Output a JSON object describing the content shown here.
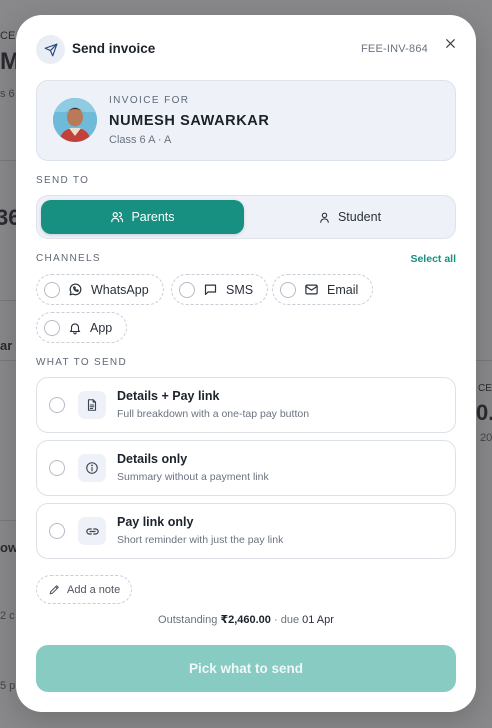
{
  "header": {
    "title": "Send invoice",
    "invoice_id": "FEE-INV-864"
  },
  "invoice_card": {
    "label": "INVOICE FOR",
    "student_name": "NUMESH SAWARKAR",
    "class_info": "Class 6 A · A"
  },
  "send_to": {
    "label": "SEND TO",
    "options": [
      {
        "label": "Parents",
        "selected": true
      },
      {
        "label": "Student",
        "selected": false
      }
    ]
  },
  "channels": {
    "label": "CHANNELS",
    "select_all": "Select all",
    "items": [
      {
        "label": "WhatsApp",
        "icon": "whatsapp-icon",
        "selected": false
      },
      {
        "label": "SMS",
        "icon": "message-icon",
        "selected": false
      },
      {
        "label": "Email",
        "icon": "mail-icon",
        "selected": false
      },
      {
        "label": "App",
        "icon": "bell-icon",
        "selected": false
      }
    ]
  },
  "what_to_send": {
    "label": "WHAT TO SEND",
    "options": [
      {
        "title": "Details + Pay link",
        "subtitle": "Full breakdown with a one-tap pay button",
        "icon": "document-icon"
      },
      {
        "title": "Details only",
        "subtitle": "Summary without a payment link",
        "icon": "info-icon"
      },
      {
        "title": "Pay link only",
        "subtitle": "Short reminder with just the pay link",
        "icon": "link-icon"
      }
    ]
  },
  "note": {
    "label": "Add a note"
  },
  "summary": {
    "outstanding_label": "Outstanding",
    "amount": "₹2,460.00",
    "due_label": "· due",
    "due_date": "01 Apr"
  },
  "cta": {
    "label": "Pick what to send"
  },
  "colors": {
    "accent": "#178f81",
    "cta_disabled": "#88cbc2"
  },
  "background_fragments": {
    "top_left_small": "CE",
    "top_left_big": "M",
    "left_row1": "s 6",
    "left_big": "36",
    "left_ar": "ar",
    "right_ce": "CE",
    "right_big": "0.",
    "right_small": "20",
    "left_ow": "ow",
    "left_2c": "2 c",
    "left_5p": "5 p"
  }
}
